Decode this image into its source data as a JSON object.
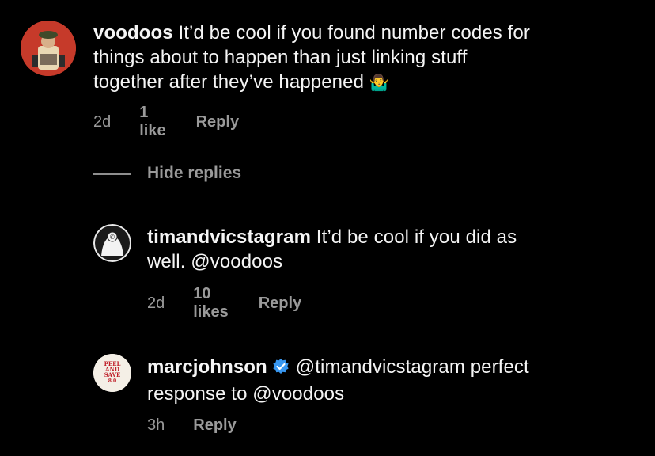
{
  "comments": [
    {
      "username": "voodoos",
      "text_line1": "It’d be cool if you found number codes for",
      "text_line2": "things about to happen than just linking stuff",
      "text_line3": "together after they’ve happened",
      "emoji": "🤷‍♂️",
      "time": "2d",
      "likes": "1 like",
      "reply": "Reply"
    },
    {
      "username": "timandvicstagram",
      "text_line1": "It’d be cool if you did as",
      "text_line2": "well. @voodoos",
      "time": "2d",
      "likes": "10 likes",
      "reply": "Reply"
    },
    {
      "username": "marcjohnson",
      "text_line1": "@timandvicstagram perfect",
      "text_line2": "response to @voodoos",
      "time": "3h",
      "reply": "Reply",
      "avatar_text": [
        "PEEL",
        "AND",
        "SAVE",
        "8.0"
      ]
    }
  ],
  "hide_replies": "Hide replies",
  "colors": {
    "background": "#000000",
    "text": "#f5f5f5",
    "muted": "#9a9a9a",
    "verified": "#3897f0"
  }
}
